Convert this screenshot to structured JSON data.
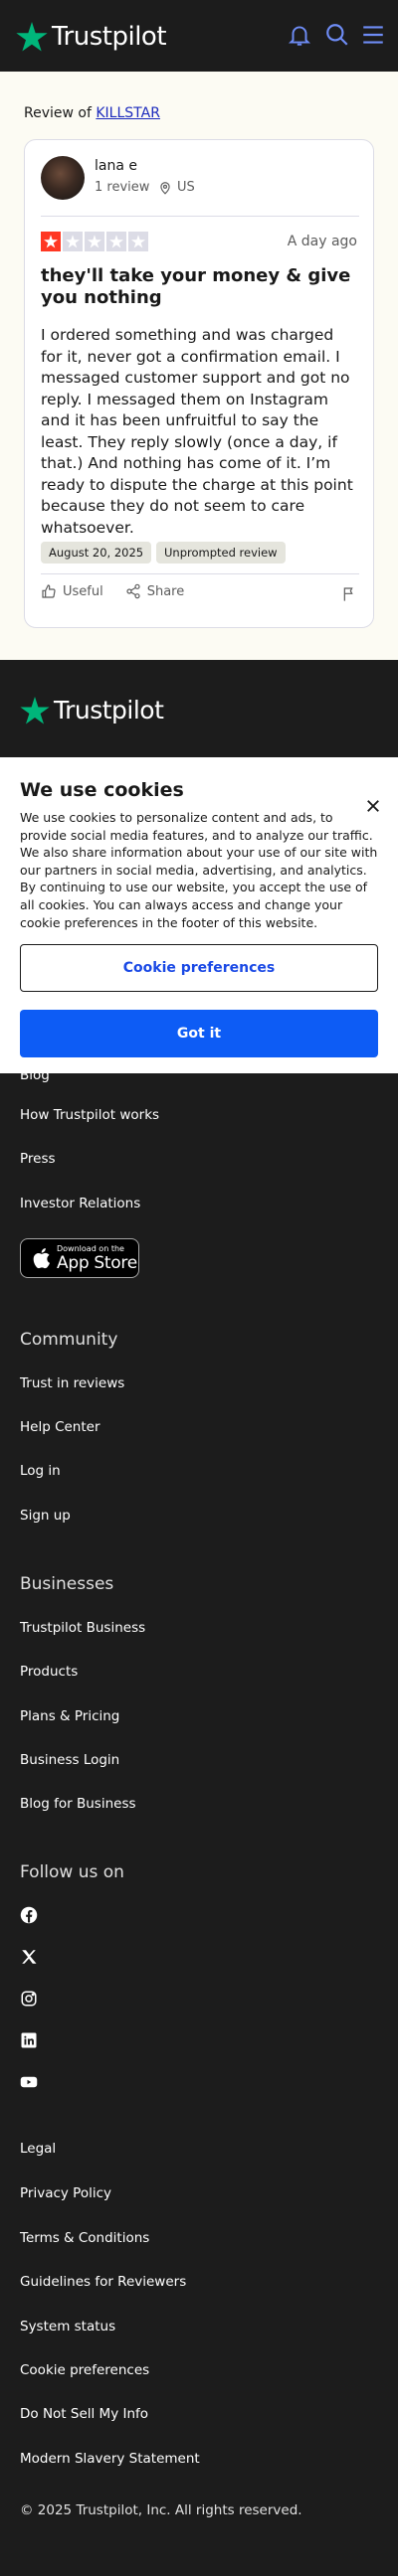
{
  "header": {
    "brand": "Trustpilot",
    "icons": [
      "bell-icon",
      "search-icon",
      "menu-icon"
    ],
    "accent": "#00b67a"
  },
  "review": {
    "review_of_prefix": "Review of",
    "company": "KILLSTAR",
    "reviewer_name": "lana e",
    "reviewer_count": "1 review",
    "reviewer_country": "US",
    "rating": 1,
    "max_rating": 5,
    "rating_color": "#ff3722",
    "date": "A day ago",
    "title": "they'll take your money & give you nothing",
    "body": "I ordered something and was charged for it, never got a confirmation email. I messaged customer support and got no reply. I messaged them on Instagram and it has been unfruitful to say the least. They reply slowly (once a day, if that.) And nothing has come of it. I’m ready to dispute the charge at this point because they do not seem to care whatsoever.",
    "experience_date": "August 20, 2025",
    "tag": "Unprompted review",
    "useful_label": "Useful",
    "share_label": "Share"
  },
  "footer": {
    "brand": "Trustpilot",
    "links_partial": [
      "Blog",
      "How Trustpilot works",
      "Press",
      "Investor Relations"
    ],
    "appstore_small": "Download on the",
    "appstore_big": "App Store",
    "community_heading": "Community",
    "community_links": [
      "Trust in reviews",
      "Help Center",
      "Log in",
      "Sign up"
    ],
    "businesses_heading": "Businesses",
    "businesses_links": [
      "Trustpilot Business",
      "Products",
      "Plans & Pricing",
      "Business Login",
      "Blog for Business"
    ],
    "follow_heading": "Follow us on",
    "social_icons": [
      "facebook-icon",
      "x-icon",
      "instagram-icon",
      "linkedin-icon",
      "youtube-icon"
    ],
    "legal_links": [
      "Legal",
      "Privacy Policy",
      "Terms & Conditions",
      "Guidelines for Reviewers",
      "System status",
      "Cookie preferences",
      "Do Not Sell My Info",
      "Modern Slavery Statement"
    ],
    "copyright": "© 2025 Trustpilot, Inc. All rights reserved."
  },
  "cookie_banner": {
    "title": "We use cookies",
    "text": "We use cookies to personalize content and ads, to provide social media features, and to analyze our traffic. We also share information about your use of our site with our partners in social media, advertising, and analytics. By continuing to use our website, you accept the use of all cookies. You can always access and change your cookie preferences in the footer of this website.",
    "preferences_label": "Cookie preferences",
    "accept_label": "Got it",
    "accept_color": "#0d5cf5"
  }
}
